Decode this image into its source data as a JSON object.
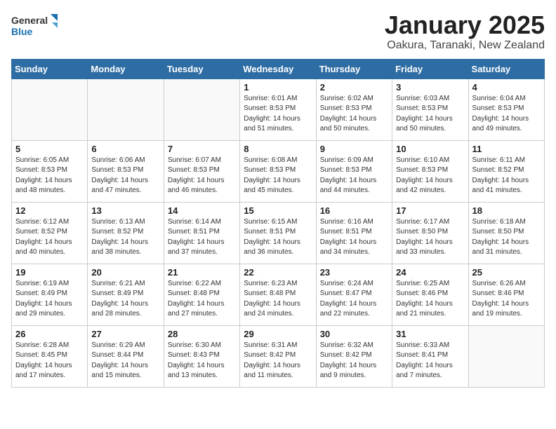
{
  "logo": {
    "general": "General",
    "blue": "Blue"
  },
  "title": "January 2025",
  "subtitle": "Oakura, Taranaki, New Zealand",
  "weekdays": [
    "Sunday",
    "Monday",
    "Tuesday",
    "Wednesday",
    "Thursday",
    "Friday",
    "Saturday"
  ],
  "weeks": [
    [
      {
        "day": "",
        "sunrise": "",
        "sunset": "",
        "daylight": ""
      },
      {
        "day": "",
        "sunrise": "",
        "sunset": "",
        "daylight": ""
      },
      {
        "day": "",
        "sunrise": "",
        "sunset": "",
        "daylight": ""
      },
      {
        "day": "1",
        "sunrise": "Sunrise: 6:01 AM",
        "sunset": "Sunset: 8:53 PM",
        "daylight": "Daylight: 14 hours and 51 minutes."
      },
      {
        "day": "2",
        "sunrise": "Sunrise: 6:02 AM",
        "sunset": "Sunset: 8:53 PM",
        "daylight": "Daylight: 14 hours and 50 minutes."
      },
      {
        "day": "3",
        "sunrise": "Sunrise: 6:03 AM",
        "sunset": "Sunset: 8:53 PM",
        "daylight": "Daylight: 14 hours and 50 minutes."
      },
      {
        "day": "4",
        "sunrise": "Sunrise: 6:04 AM",
        "sunset": "Sunset: 8:53 PM",
        "daylight": "Daylight: 14 hours and 49 minutes."
      }
    ],
    [
      {
        "day": "5",
        "sunrise": "Sunrise: 6:05 AM",
        "sunset": "Sunset: 8:53 PM",
        "daylight": "Daylight: 14 hours and 48 minutes."
      },
      {
        "day": "6",
        "sunrise": "Sunrise: 6:06 AM",
        "sunset": "Sunset: 8:53 PM",
        "daylight": "Daylight: 14 hours and 47 minutes."
      },
      {
        "day": "7",
        "sunrise": "Sunrise: 6:07 AM",
        "sunset": "Sunset: 8:53 PM",
        "daylight": "Daylight: 14 hours and 46 minutes."
      },
      {
        "day": "8",
        "sunrise": "Sunrise: 6:08 AM",
        "sunset": "Sunset: 8:53 PM",
        "daylight": "Daylight: 14 hours and 45 minutes."
      },
      {
        "day": "9",
        "sunrise": "Sunrise: 6:09 AM",
        "sunset": "Sunset: 8:53 PM",
        "daylight": "Daylight: 14 hours and 44 minutes."
      },
      {
        "day": "10",
        "sunrise": "Sunrise: 6:10 AM",
        "sunset": "Sunset: 8:53 PM",
        "daylight": "Daylight: 14 hours and 42 minutes."
      },
      {
        "day": "11",
        "sunrise": "Sunrise: 6:11 AM",
        "sunset": "Sunset: 8:52 PM",
        "daylight": "Daylight: 14 hours and 41 minutes."
      }
    ],
    [
      {
        "day": "12",
        "sunrise": "Sunrise: 6:12 AM",
        "sunset": "Sunset: 8:52 PM",
        "daylight": "Daylight: 14 hours and 40 minutes."
      },
      {
        "day": "13",
        "sunrise": "Sunrise: 6:13 AM",
        "sunset": "Sunset: 8:52 PM",
        "daylight": "Daylight: 14 hours and 38 minutes."
      },
      {
        "day": "14",
        "sunrise": "Sunrise: 6:14 AM",
        "sunset": "Sunset: 8:51 PM",
        "daylight": "Daylight: 14 hours and 37 minutes."
      },
      {
        "day": "15",
        "sunrise": "Sunrise: 6:15 AM",
        "sunset": "Sunset: 8:51 PM",
        "daylight": "Daylight: 14 hours and 36 minutes."
      },
      {
        "day": "16",
        "sunrise": "Sunrise: 6:16 AM",
        "sunset": "Sunset: 8:51 PM",
        "daylight": "Daylight: 14 hours and 34 minutes."
      },
      {
        "day": "17",
        "sunrise": "Sunrise: 6:17 AM",
        "sunset": "Sunset: 8:50 PM",
        "daylight": "Daylight: 14 hours and 33 minutes."
      },
      {
        "day": "18",
        "sunrise": "Sunrise: 6:18 AM",
        "sunset": "Sunset: 8:50 PM",
        "daylight": "Daylight: 14 hours and 31 minutes."
      }
    ],
    [
      {
        "day": "19",
        "sunrise": "Sunrise: 6:19 AM",
        "sunset": "Sunset: 8:49 PM",
        "daylight": "Daylight: 14 hours and 29 minutes."
      },
      {
        "day": "20",
        "sunrise": "Sunrise: 6:21 AM",
        "sunset": "Sunset: 8:49 PM",
        "daylight": "Daylight: 14 hours and 28 minutes."
      },
      {
        "day": "21",
        "sunrise": "Sunrise: 6:22 AM",
        "sunset": "Sunset: 8:48 PM",
        "daylight": "Daylight: 14 hours and 27 minutes."
      },
      {
        "day": "22",
        "sunrise": "Sunrise: 6:23 AM",
        "sunset": "Sunset: 8:48 PM",
        "daylight": "Daylight: 14 hours and 24 minutes."
      },
      {
        "day": "23",
        "sunrise": "Sunrise: 6:24 AM",
        "sunset": "Sunset: 8:47 PM",
        "daylight": "Daylight: 14 hours and 22 minutes."
      },
      {
        "day": "24",
        "sunrise": "Sunrise: 6:25 AM",
        "sunset": "Sunset: 8:46 PM",
        "daylight": "Daylight: 14 hours and 21 minutes."
      },
      {
        "day": "25",
        "sunrise": "Sunrise: 6:26 AM",
        "sunset": "Sunset: 8:46 PM",
        "daylight": "Daylight: 14 hours and 19 minutes."
      }
    ],
    [
      {
        "day": "26",
        "sunrise": "Sunrise: 6:28 AM",
        "sunset": "Sunset: 8:45 PM",
        "daylight": "Daylight: 14 hours and 17 minutes."
      },
      {
        "day": "27",
        "sunrise": "Sunrise: 6:29 AM",
        "sunset": "Sunset: 8:44 PM",
        "daylight": "Daylight: 14 hours and 15 minutes."
      },
      {
        "day": "28",
        "sunrise": "Sunrise: 6:30 AM",
        "sunset": "Sunset: 8:43 PM",
        "daylight": "Daylight: 14 hours and 13 minutes."
      },
      {
        "day": "29",
        "sunrise": "Sunrise: 6:31 AM",
        "sunset": "Sunset: 8:42 PM",
        "daylight": "Daylight: 14 hours and 11 minutes."
      },
      {
        "day": "30",
        "sunrise": "Sunrise: 6:32 AM",
        "sunset": "Sunset: 8:42 PM",
        "daylight": "Daylight: 14 hours and 9 minutes."
      },
      {
        "day": "31",
        "sunrise": "Sunrise: 6:33 AM",
        "sunset": "Sunset: 8:41 PM",
        "daylight": "Daylight: 14 hours and 7 minutes."
      },
      {
        "day": "",
        "sunrise": "",
        "sunset": "",
        "daylight": ""
      }
    ]
  ]
}
